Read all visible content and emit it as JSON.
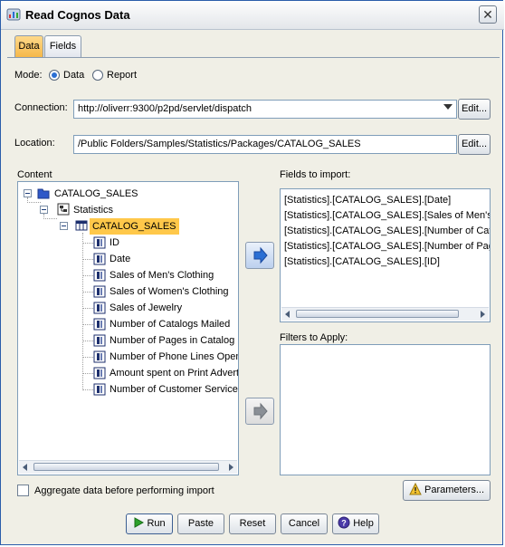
{
  "window": {
    "title": "Read Cognos Data"
  },
  "tabs": [
    {
      "label": "Data",
      "active": true
    },
    {
      "label": "Fields",
      "active": false
    }
  ],
  "mode": {
    "label": "Mode:",
    "options": [
      "Data",
      "Report"
    ],
    "selected": "Data"
  },
  "connection": {
    "label": "Connection:",
    "value": "http://oliverr:9300/p2pd/servlet/dispatch",
    "edit_label": "Edit..."
  },
  "location": {
    "label": "Location:",
    "value": "/Public Folders/Samples/Statistics/Packages/CATALOG_SALES",
    "edit_label": "Edit..."
  },
  "content": {
    "label": "Content",
    "root": "CATALOG_SALES",
    "namespace": "Statistics",
    "query_subject": "CATALOG_SALES",
    "fields": [
      "ID",
      "Date",
      "Sales of Men's Clothing",
      "Sales of Women's Clothing",
      "Sales of Jewelry",
      "Number of Catalogs Mailed",
      "Number of Pages in Catalog",
      "Number of Phone Lines Open",
      "Amount spent on Print Advert",
      "Number of Customer Service"
    ]
  },
  "fields_to_import": {
    "label": "Fields to import:",
    "items": [
      "[Statistics].[CATALOG_SALES].[Date]",
      "[Statistics].[CATALOG_SALES].[Sales of Men's",
      "[Statistics].[CATALOG_SALES].[Number of Cat",
      "[Statistics].[CATALOG_SALES].[Number of Pag",
      "[Statistics].[CATALOG_SALES].[ID]"
    ]
  },
  "filters": {
    "label": "Filters to Apply:"
  },
  "aggregate": {
    "label": "Aggregate data before performing import",
    "checked": false
  },
  "parameters_label": "Parameters...",
  "buttons": {
    "run": "Run",
    "paste": "Paste",
    "reset": "Reset",
    "cancel": "Cancel",
    "help": "Help"
  },
  "colors": {
    "accent": "#2a6fd4",
    "tab_active": "#f5b84a",
    "selection": "#ffc84a"
  }
}
